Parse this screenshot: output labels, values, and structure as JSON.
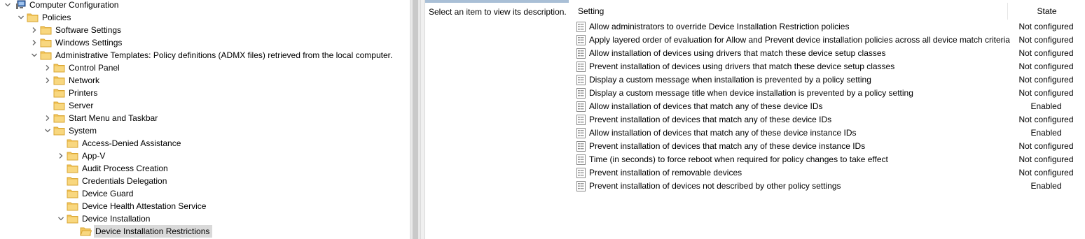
{
  "tree": {
    "items": [
      {
        "label": "Computer Configuration",
        "icon": "computer-icon",
        "expander": "down"
      },
      {
        "label": "Policies",
        "icon": "folder-icon",
        "expander": "down"
      },
      {
        "label": "Software Settings",
        "icon": "folder-icon",
        "expander": "right"
      },
      {
        "label": "Windows Settings",
        "icon": "folder-icon",
        "expander": "right"
      },
      {
        "label": "Administrative Templates: Policy definitions (ADMX files) retrieved from the local computer.",
        "icon": "folder-icon",
        "expander": "down"
      },
      {
        "label": "Control Panel",
        "icon": "folder-icon",
        "expander": "right"
      },
      {
        "label": "Network",
        "icon": "folder-icon",
        "expander": "right"
      },
      {
        "label": "Printers",
        "icon": "folder-icon",
        "expander": "none"
      },
      {
        "label": "Server",
        "icon": "folder-icon",
        "expander": "none"
      },
      {
        "label": "Start Menu and Taskbar",
        "icon": "folder-icon",
        "expander": "right"
      },
      {
        "label": "System",
        "icon": "folder-icon",
        "expander": "down"
      },
      {
        "label": "Access-Denied Assistance",
        "icon": "folder-icon",
        "expander": "none"
      },
      {
        "label": "App-V",
        "icon": "folder-icon",
        "expander": "right"
      },
      {
        "label": "Audit Process Creation",
        "icon": "folder-icon",
        "expander": "none"
      },
      {
        "label": "Credentials Delegation",
        "icon": "folder-icon",
        "expander": "none"
      },
      {
        "label": "Device Guard",
        "icon": "folder-icon",
        "expander": "none"
      },
      {
        "label": "Device Health Attestation Service",
        "icon": "folder-icon",
        "expander": "none"
      },
      {
        "label": "Device Installation",
        "icon": "folder-icon",
        "expander": "down"
      },
      {
        "label": "Device Installation Restrictions",
        "icon": "open-folder-icon",
        "expander": "none",
        "selected": true
      }
    ]
  },
  "description": {
    "text": "Select an item to view its description."
  },
  "list": {
    "headers": {
      "setting": "Setting",
      "state": "State"
    },
    "rows": [
      {
        "name": "Allow administrators to override Device Installation Restriction policies",
        "state": "Not configured"
      },
      {
        "name": "Apply layered order of evaluation for Allow and Prevent device installation policies across all device match criteria",
        "state": "Not configured"
      },
      {
        "name": "Allow installation of devices using drivers that match these device setup classes",
        "state": "Not configured"
      },
      {
        "name": "Prevent installation of devices using drivers that match these device setup classes",
        "state": "Not configured"
      },
      {
        "name": "Display a custom message when installation is prevented by a policy setting",
        "state": "Not configured"
      },
      {
        "name": "Display a custom message title when device installation is prevented by a policy setting",
        "state": "Not configured"
      },
      {
        "name": "Allow installation of devices that match any of these device IDs",
        "state": "Enabled"
      },
      {
        "name": "Prevent installation of devices that match any of these device IDs",
        "state": "Not configured"
      },
      {
        "name": "Allow installation of devices that match any of these device instance IDs",
        "state": "Enabled"
      },
      {
        "name": "Prevent installation of devices that match any of these device instance IDs",
        "state": "Not configured"
      },
      {
        "name": "Time (in seconds) to force reboot when required for policy changes to take effect",
        "state": "Not configured"
      },
      {
        "name": "Prevent installation of removable devices",
        "state": "Not configured"
      },
      {
        "name": "Prevent installation of devices not described by other policy settings",
        "state": "Enabled"
      }
    ]
  },
  "colors": {
    "folder": "#f2c55c",
    "folder_edge": "#d8a532",
    "selection": "#d9d9d9",
    "header_tab": "#a9bfd6"
  }
}
